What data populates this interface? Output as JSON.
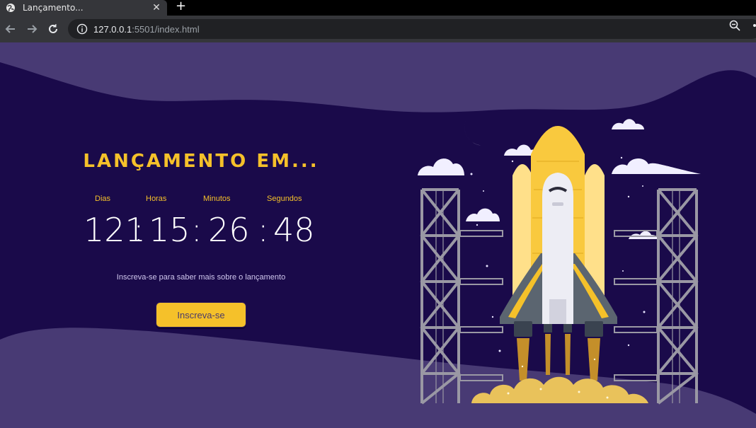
{
  "browser": {
    "tab_title": "Lançamento...",
    "tab_close": "✕",
    "new_tab": "+",
    "url_host": "127.0.0.1",
    "url_rest": ":5501/index.html",
    "icons": {
      "favicon": "globe-icon",
      "back": "arrow-left-icon",
      "forward": "arrow-right-icon",
      "reload": "reload-icon",
      "site_info": "info-icon",
      "zoom": "zoom-icon",
      "share": "share-icon"
    }
  },
  "launch": {
    "heading": "LANÇAMENTO EM...",
    "labels": {
      "days": "Dias",
      "hours": "Horas",
      "minutes": "Minutos",
      "seconds": "Segundos"
    },
    "timer": {
      "days": "121",
      "hours": "15",
      "minutes": "26",
      "seconds": "48",
      "separator": ":"
    },
    "subtitle": "Inscreva-se para saber mais sobre o lançamento",
    "button_label": "Inscreva-se"
  },
  "colors": {
    "background": "#1a0a4a",
    "wave": "#483a74",
    "accent": "#f5c12a",
    "text": "#ffffff"
  }
}
